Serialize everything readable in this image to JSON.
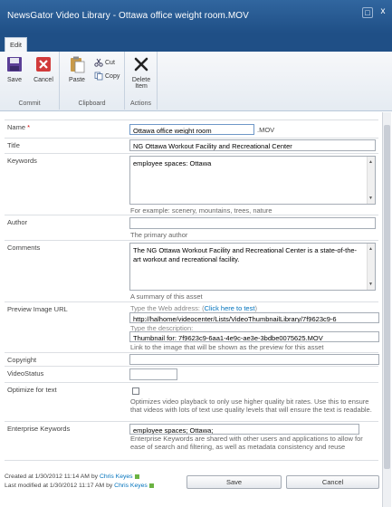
{
  "dialog": {
    "title": "NewsGator Video Library - Ottawa office weight room.MOV",
    "maximize_glyph": "□",
    "close_glyph": "x"
  },
  "ribbon": {
    "tab_label": "Edit",
    "commit": {
      "label": "Commit",
      "save": "Save",
      "cancel": "Cancel"
    },
    "clipboard": {
      "label": "Clipboard",
      "paste": "Paste",
      "cut": "Cut",
      "copy": "Copy"
    },
    "actions": {
      "label": "Actions",
      "delete_line1": "Delete",
      "delete_line2": "Item"
    }
  },
  "form": {
    "name": {
      "label": "Name",
      "required_mark": "*",
      "value": "Ottawa office weight room",
      "suffix": ".MOV"
    },
    "title": {
      "label": "Title",
      "value": "NG Ottawa Workout Facility and Recreational Center"
    },
    "keywords": {
      "label": "Keywords",
      "value": "employee spaces: Ottawa",
      "hint": "For example: scenery, mountains, trees, nature"
    },
    "author": {
      "label": "Author",
      "value": "",
      "hint": "The primary author"
    },
    "comments": {
      "label": "Comments",
      "value": "The NG Ottawa Workout Facility and Recreational Center is a state-of-the-art workout and recreational facility.",
      "hint": "A summary of this asset"
    },
    "preview_image_url": {
      "label": "Preview Image URL",
      "address_hint_prefix": "Type the Web address: (",
      "address_hint_link": "Click here to test",
      "address_hint_suffix": ")",
      "address_value": "http://halhome/videocenter/Lists/VideoThumbnailLibrary/7f9623c9-6",
      "description_hint": "Type the description:",
      "description_value": "Thumbnail for: 7f9623c9-6aa1-4e9c-ae3e-3bdbe0075625.MOV",
      "hint": "Link to the image that will be shown as the preview for this asset"
    },
    "copyright": {
      "label": "Copyright",
      "value": ""
    },
    "video_status": {
      "label": "VideoStatus",
      "value": ""
    },
    "optimize_for_text": {
      "label": "Optimize for text",
      "checked": false,
      "hint": "Optimizes video playback to only use higher quality bit rates. Use this to ensure that videos with lots of text use quality levels that will ensure the text is readable."
    },
    "enterprise_keywords": {
      "label": "Enterprise Keywords",
      "value": "employee spaces; Ottawa;",
      "hint": "Enterprise Keywords are shared with other users and applications to allow for ease of search and filtering, as well as metadata consistency and reuse"
    }
  },
  "footer": {
    "created_prefix": "Created at 1/30/2012 11:14 AM by",
    "created_by": "Chris Keyes",
    "modified_prefix": "Last modified at 1/30/2012 11:17 AM by",
    "modified_by": "Chris Keyes",
    "save_label": "Save",
    "cancel_label": "Cancel"
  },
  "colors": {
    "titlebar": "#1f4f86",
    "link": "#0072bc",
    "presence": "#6bb343"
  }
}
